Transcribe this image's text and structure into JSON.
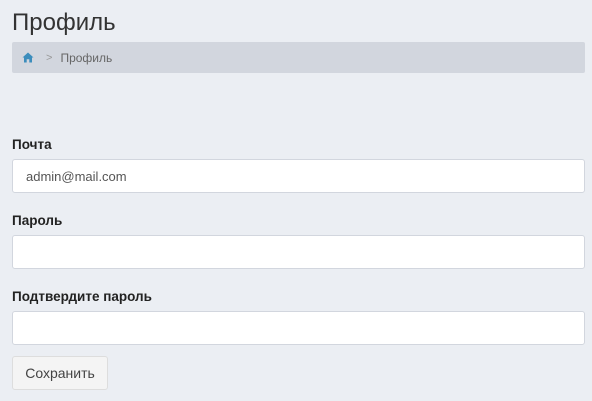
{
  "header": {
    "title": "Профиль"
  },
  "breadcrumb": {
    "home_icon": "home-icon",
    "separator": ">",
    "current": "Профиль"
  },
  "form": {
    "email": {
      "label": "Почта",
      "value": "admin@mail.com"
    },
    "password": {
      "label": "Пароль",
      "value": ""
    },
    "confirm_password": {
      "label": "Подтвердите пароль",
      "value": ""
    },
    "save_label": "Сохранить"
  },
  "colors": {
    "background": "#ebeef3",
    "breadcrumb_bg": "#d2d6de",
    "home_icon": "#3c8dbc",
    "button_bg": "#f4f4f4"
  }
}
